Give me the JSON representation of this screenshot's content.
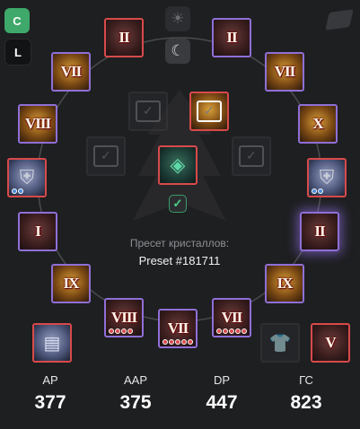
{
  "corner_buttons": {
    "c_label": "C",
    "l_label": "L"
  },
  "slots": {
    "helm_left": {
      "numeral": "II",
      "icon": "helmet-icon"
    },
    "helm_right": {
      "numeral": "II",
      "icon": "helmet-icon"
    },
    "neck_left": {
      "numeral": "VII",
      "icon": "necklace-icon"
    },
    "ring_right_top": {
      "numeral": "VII",
      "icon": "ring-icon"
    },
    "belt_left": {
      "numeral": "VIII",
      "icon": "belt-icon"
    },
    "earring_right": {
      "numeral": "X",
      "icon": "earring-icon"
    },
    "glove_left": {
      "numeral": "I",
      "icon": "glove-icon"
    },
    "glove_right": {
      "numeral": "II",
      "icon": "glove-icon"
    },
    "ring_left_low": {
      "numeral": "IX",
      "icon": "ring-icon"
    },
    "ring_right_low": {
      "numeral": "IX",
      "icon": "ring-icon"
    },
    "boots_left": {
      "numeral": "VIII",
      "icon": "boots-icon"
    },
    "boots_mid": {
      "numeral": "VII",
      "icon": "boots-icon"
    },
    "boots_right": {
      "numeral": "VII",
      "icon": "boots-icon"
    },
    "weapon_right": {
      "numeral": "V",
      "icon": "sword-icon"
    }
  },
  "preset": {
    "caption": "Пресет кристаллов:",
    "name": "Preset #181711"
  },
  "stats": [
    {
      "label": "AP",
      "value": "377"
    },
    {
      "label": "AAP",
      "value": "375"
    },
    {
      "label": "DP",
      "value": "447"
    },
    {
      "label": "ГС",
      "value": "823"
    }
  ],
  "colors": {
    "slot_purple": "#8f6fd6",
    "slot_red": "#d84a4a",
    "accent_green": "#3ea96a"
  }
}
